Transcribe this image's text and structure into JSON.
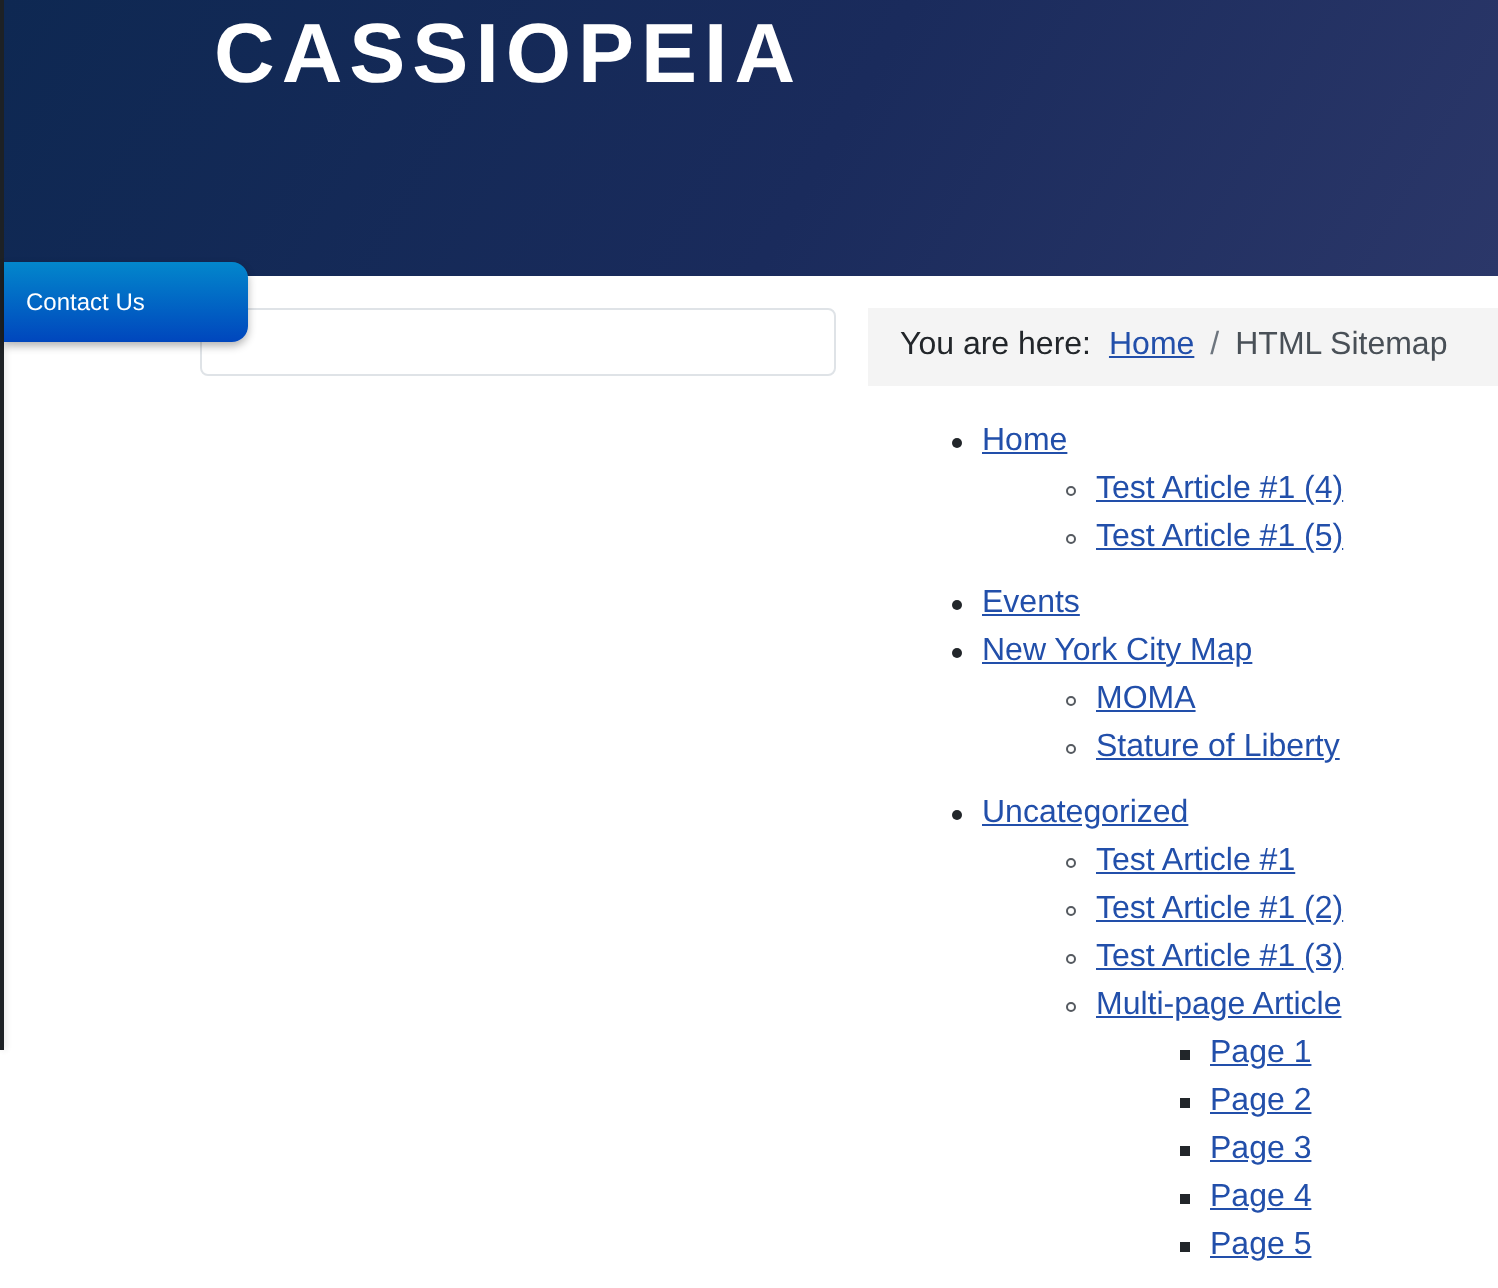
{
  "header": {
    "logo": "CASSIOPEIA"
  },
  "contact_tab": {
    "label": "Contact Us"
  },
  "breadcrumb": {
    "prefix": "You are here:",
    "separator": "/",
    "items": [
      {
        "label": "Home",
        "current": false
      },
      {
        "label": "HTML Sitemap",
        "current": true
      }
    ]
  },
  "sitemap": [
    {
      "label": "Home",
      "children": [
        {
          "label": "Test Article #1 (4)"
        },
        {
          "label": "Test Article #1 (5)"
        }
      ]
    },
    {
      "label": "Events"
    },
    {
      "label": "New York City Map",
      "children": [
        {
          "label": "MOMA"
        },
        {
          "label": "Stature of Liberty"
        }
      ]
    },
    {
      "label": "Uncategorized",
      "children": [
        {
          "label": "Test Article #1"
        },
        {
          "label": "Test Article #1 (2)"
        },
        {
          "label": "Test Article #1 (3)"
        },
        {
          "label": "Multi-page Article",
          "children": [
            {
              "label": "Page 1"
            },
            {
              "label": "Page 2"
            },
            {
              "label": "Page 3"
            },
            {
              "label": "Page 4"
            },
            {
              "label": "Page 5"
            }
          ]
        }
      ]
    }
  ]
}
